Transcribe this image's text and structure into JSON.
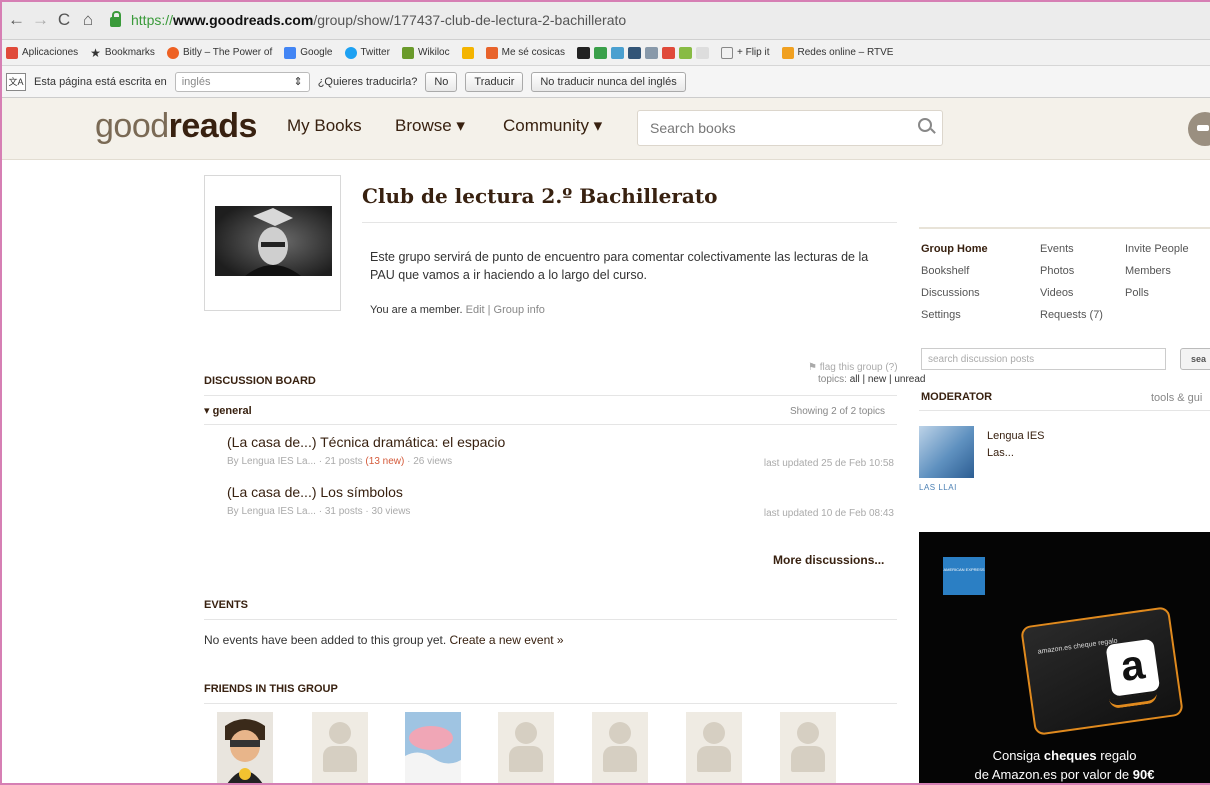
{
  "browser": {
    "url_scheme": "https://",
    "url_host": "www.goodreads.com",
    "url_path": "/group/show/177437-club-de-lectura-2-bachillerato",
    "bookmarks": [
      {
        "label": "Aplicaciones",
        "color": "#e04a3a"
      },
      {
        "label": "Bookmarks",
        "color": "#333333"
      },
      {
        "label": "Bitly – The Power of",
        "color": "#ee6123"
      },
      {
        "label": "Google",
        "color": "#4285f4"
      },
      {
        "label": "Twitter",
        "color": "#1da1f2"
      },
      {
        "label": "Wikiloc",
        "color": "#6a9a2a"
      },
      {
        "label": "",
        "color": "#f4b400"
      },
      {
        "label": "Me sé cosicas",
        "color": "#e8632b"
      }
    ],
    "bookmark_icon_colors": [
      "#222222",
      "#3aa04a",
      "#4aa0d0",
      "#335577",
      "#8899aa",
      "#e04a3a",
      "#88bb44",
      "#dddddd"
    ],
    "bookmarks_tail": [
      {
        "label": "+ Flip it",
        "color": "#888888"
      },
      {
        "label": "Redes online – RTVE",
        "color": "#f0a020"
      }
    ]
  },
  "translate_bar": {
    "icon_text": "文A",
    "message": "Esta página está escrita en",
    "language": "inglés",
    "question": "¿Quieres traducirla?",
    "no": "No",
    "translate": "Traducir",
    "never": "No traducir nunca del inglés"
  },
  "header": {
    "logo_light": "good",
    "logo_bold": "reads",
    "nav": [
      "My Books",
      "Browse ▾",
      "Community ▾"
    ],
    "search_placeholder": "Search books"
  },
  "group": {
    "title": "Club de lectura 2.º Bachillerato",
    "description": "Este grupo servirá de punto de encuentro para comentar colectivamente las lecturas de la PAU que vamos a ir haciendo a lo largo del curso.",
    "member_text": "You are a member.",
    "member_links": "Edit | Group info"
  },
  "discussion": {
    "flag": "⚑ flag this group (?)",
    "heading": "DISCUSSION BOARD",
    "topics_label": "topics:",
    "topics_filters": "all | new | unread",
    "folder": "▾ general",
    "showing": "Showing 2 of 2 topics",
    "topics": [
      {
        "title": "(La casa de...) Técnica dramática: el espacio",
        "meta_a": "By Lengua IES La... · 21 posts",
        "meta_new": "(13 new)",
        "meta_b": "· 26 views",
        "updated": "last updated 25 de Feb 10:58"
      },
      {
        "title": "(La casa de...) Los símbolos",
        "meta_a": "By Lengua IES La... · 31 posts · 30 views",
        "meta_new": "",
        "meta_b": "",
        "updated": "last updated 10 de Feb 08:43"
      }
    ],
    "more": "More discussions..."
  },
  "events": {
    "heading": "EVENTS",
    "empty": "No events have been added to this group yet.",
    "create": "Create a new event »"
  },
  "friends": {
    "heading": "FRIENDS IN THIS GROUP"
  },
  "sidebar": {
    "links": [
      {
        "label": "Group Home",
        "active": true
      },
      {
        "label": "Events",
        "active": false
      },
      {
        "label": "Invite People",
        "active": false
      },
      {
        "label": "Bookshelf",
        "active": false
      },
      {
        "label": "Photos",
        "active": false
      },
      {
        "label": "Members",
        "active": false
      },
      {
        "label": "Discussions",
        "active": false
      },
      {
        "label": "Videos",
        "active": false
      },
      {
        "label": "Polls",
        "active": false
      },
      {
        "label": "Settings",
        "active": false
      },
      {
        "label": "Requests (7)",
        "active": false
      }
    ],
    "search_placeholder": "search discussion posts",
    "search_button": "sea",
    "moderator_heading": "MODERATOR",
    "tools": "tools & gui",
    "moderator_name_1": "Lengua IES",
    "moderator_name_2": "Las...",
    "moderator_caption": "LAS LLAI"
  },
  "ad": {
    "logo_text": "AMERICAN EXPRESS",
    "card_brand": "amazon.es cheque regalo",
    "card_letter": "a",
    "line1_a": "Consiga",
    "line1_b": "cheques",
    "line1_c": "regalo",
    "line2_a": "de Amazon.es por valor de",
    "line2_b": "90€"
  }
}
